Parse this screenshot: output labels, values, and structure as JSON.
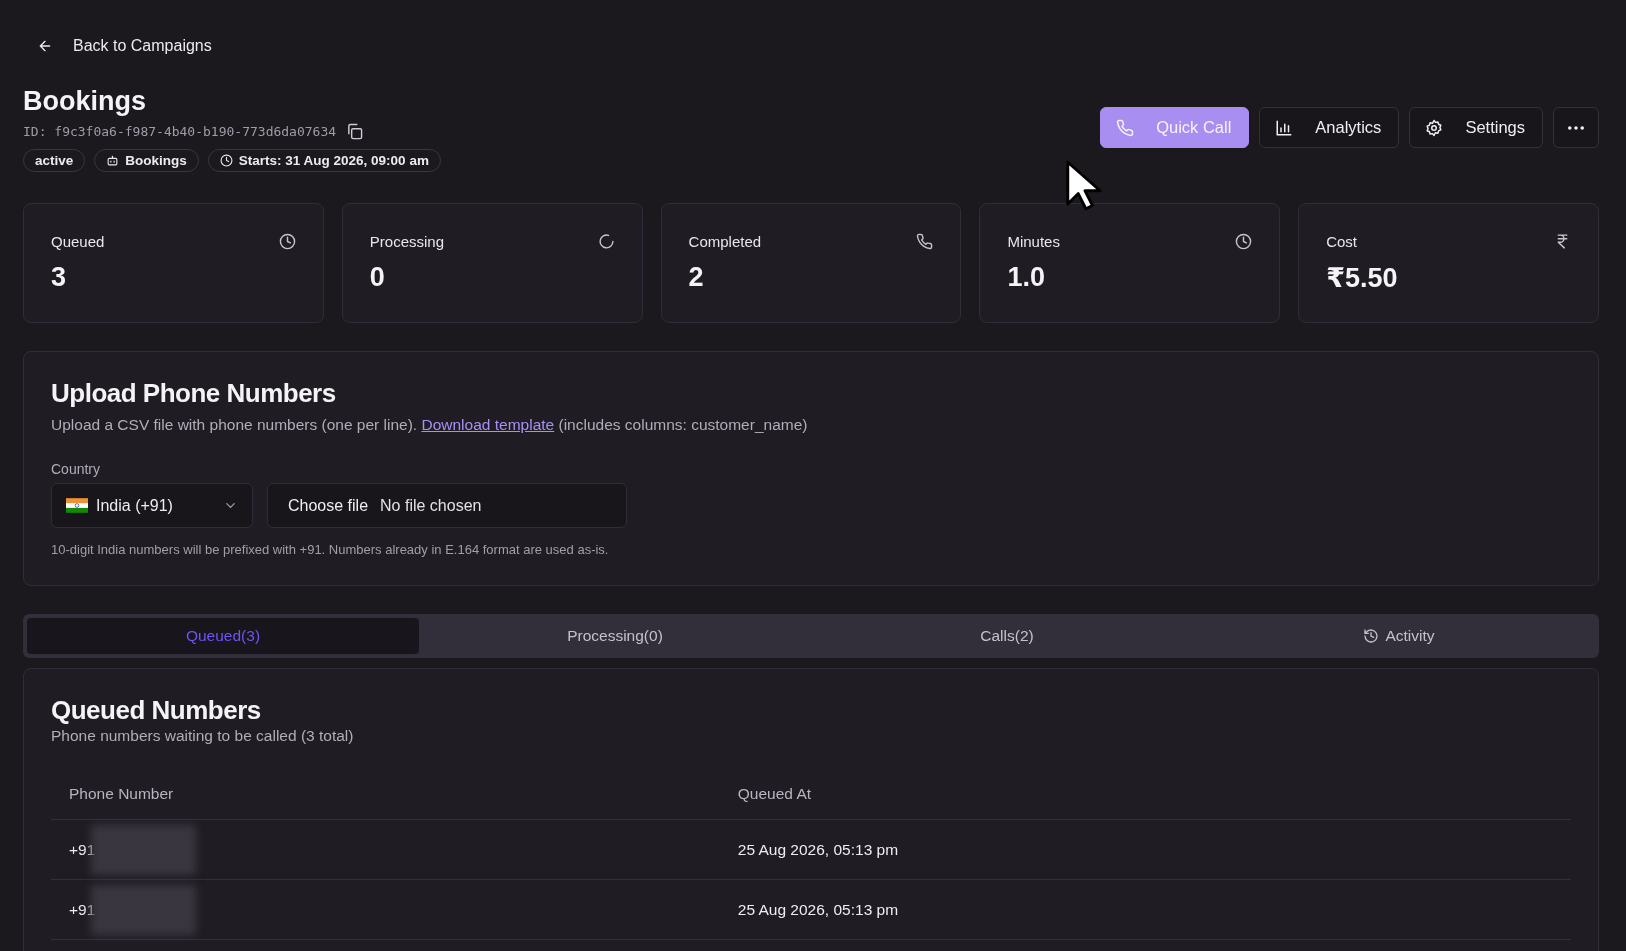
{
  "back_link": "Back to Campaigns",
  "title": "Bookings",
  "campaign_id": "ID: f9c3f0a6-f987-4b40-b190-773d6da07634",
  "badges": [
    {
      "kind": "status",
      "label": "active"
    },
    {
      "kind": "agent",
      "label": "Bookings"
    },
    {
      "kind": "schedule",
      "label": "Starts: 31 Aug 2026, 09:00 am"
    }
  ],
  "actions": [
    {
      "kind": "primary",
      "label": "Quick Call"
    },
    {
      "kind": "outline",
      "label": "Analytics"
    },
    {
      "kind": "outline",
      "label": "Settings"
    },
    {
      "kind": "more"
    }
  ],
  "stats": [
    {
      "label": "Queued",
      "value": "3"
    },
    {
      "label": "Processing",
      "value": "0"
    },
    {
      "label": "Completed",
      "value": "2"
    },
    {
      "label": "Minutes",
      "value": "1.0"
    },
    {
      "label": "Cost",
      "value": "₹5.50"
    }
  ],
  "upload": {
    "title": "Upload Phone Numbers",
    "description": "Upload a CSV file with phone numbers (one per line).",
    "link": "Download template",
    "description_after": "(includes columns: customer_name)",
    "country_label": "Country",
    "country": "India (+91)",
    "file_button": "Choose file",
    "file_status": "No file chosen",
    "hint": "10-digit India numbers will be prefixed with +91. Numbers already in E.164 format are used as-is."
  },
  "tabs": [
    {
      "label": "Queued(3)",
      "selected": true
    },
    {
      "label": "Processing(0)",
      "selected": false
    },
    {
      "label": "Calls(2)",
      "selected": false
    },
    {
      "label": "Activity",
      "selected": false
    }
  ],
  "queued": {
    "title": "Queued Numbers",
    "subtitle": "Phone numbers waiting to be called (3 total)",
    "columns": [
      "Phone Number",
      "Queued At"
    ],
    "rows": [
      {
        "phone": "+91",
        "queued_at": "25 Aug 2026, 05:13 pm"
      },
      {
        "phone": "+91",
        "queued_at": "25 Aug 2026, 05:13 pm"
      }
    ]
  }
}
